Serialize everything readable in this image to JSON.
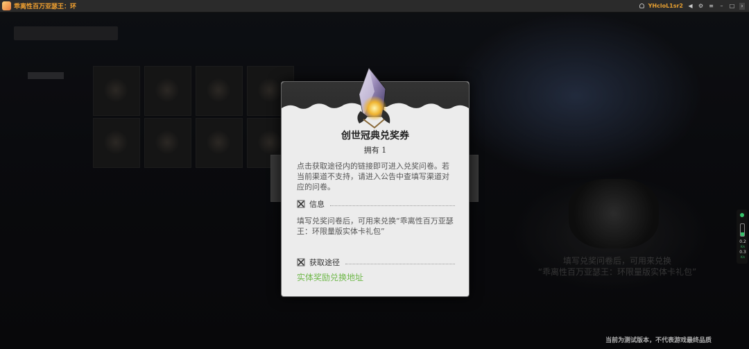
{
  "window": {
    "title": "乖离性百万亚瑟王：环",
    "username": "YHcloL1sr2"
  },
  "modal": {
    "item_name": "创世冠典兑奖券",
    "owned_text": "拥有 1",
    "description": "点击获取途径内的链接即可进入兑奖问卷。若当前渠道不支持，请进入公告中查填写渠道对应的问卷。",
    "info_section": {
      "label": "信息",
      "text": "填写兑奖问卷后，可用来兑换“乖离性百万亚瑟王：环限量版实体卡礼包”"
    },
    "source_section": {
      "label": "获取途径",
      "link_text": "实体奖励兑换地址"
    }
  },
  "background": {
    "right_text_line1": "填写兑奖问卷后，可用来兑换",
    "right_text_line2": "“乖离性百万亚瑟王：环限量版实体卡礼包”"
  },
  "side_meter": {
    "value_top": "0.2",
    "unit_top": "K/s",
    "value_bottom": "0.3",
    "unit_bottom": "K/s"
  },
  "footer_note": "当前为测试版本，不代表游戏最终品质",
  "colors": {
    "title_accent": "#f0a030",
    "link": "#6fb84a",
    "modal_bg": "#ececec"
  }
}
